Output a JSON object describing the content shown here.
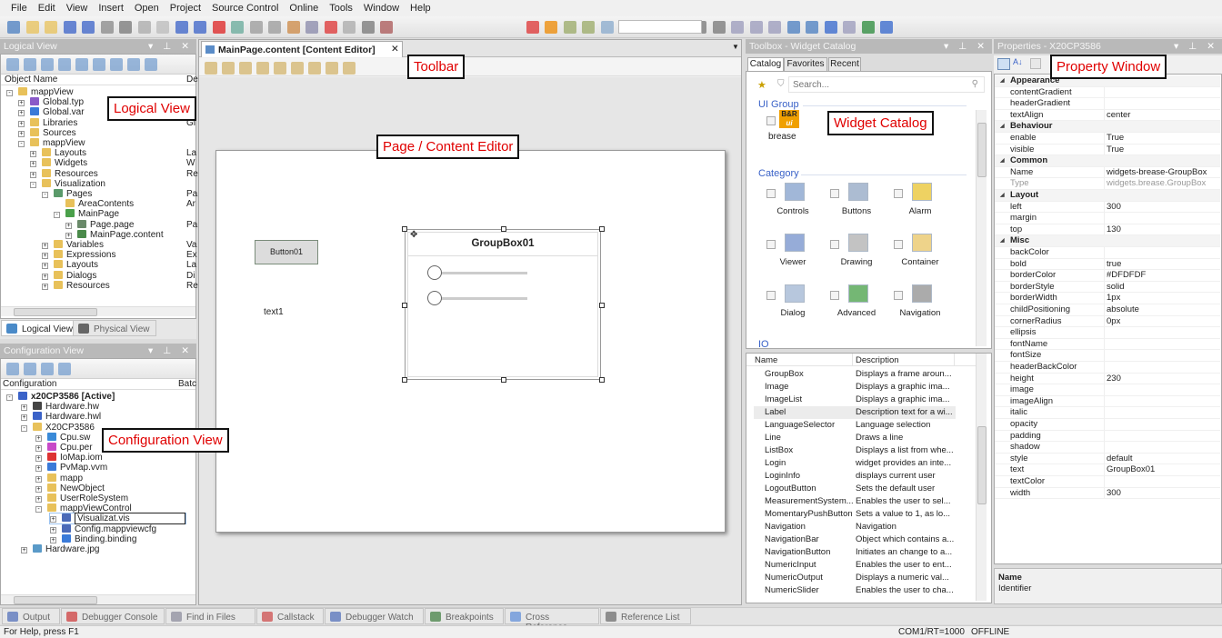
{
  "menu": [
    "File",
    "Edit",
    "View",
    "Insert",
    "Open",
    "Project",
    "Source Control",
    "Online",
    "Tools",
    "Window",
    "Help"
  ],
  "annotations": {
    "toolbar": "Toolbar",
    "logical_view": "Logical View",
    "content_editor": "Page / Content Editor",
    "widget_catalog": "Widget Catalog",
    "configuration_view": "Configuration View",
    "property_window": "Property Window"
  },
  "logical_view": {
    "title": "Logical View",
    "columns": [
      "Object Name",
      "De"
    ],
    "tree": [
      {
        "label": "mappView",
        "depth": 0,
        "exp": "-",
        "icon": "folder-open",
        "desc": ""
      },
      {
        "label": "Global.typ",
        "depth": 1,
        "exp": "+",
        "icon": "type",
        "desc": ""
      },
      {
        "label": "Global.var",
        "depth": 1,
        "exp": "+",
        "icon": "var",
        "desc": ""
      },
      {
        "label": "Libraries",
        "depth": 1,
        "exp": "+",
        "icon": "folder",
        "desc": "Gl"
      },
      {
        "label": "Sources",
        "depth": 1,
        "exp": "+",
        "icon": "folder",
        "desc": ""
      },
      {
        "label": "mappView",
        "depth": 1,
        "exp": "-",
        "icon": "folder-open",
        "desc": ""
      },
      {
        "label": "Layouts",
        "depth": 2,
        "exp": "+",
        "icon": "folder",
        "desc": "La"
      },
      {
        "label": "Widgets",
        "depth": 2,
        "exp": "+",
        "icon": "folder",
        "desc": "W"
      },
      {
        "label": "Resources",
        "depth": 2,
        "exp": "+",
        "icon": "folder",
        "desc": "Re"
      },
      {
        "label": "Visualization",
        "depth": 2,
        "exp": "-",
        "icon": "folder-open",
        "desc": ""
      },
      {
        "label": "Pages",
        "depth": 3,
        "exp": "-",
        "icon": "pages",
        "desc": "Pa"
      },
      {
        "label": "AreaContents",
        "depth": 4,
        "exp": "",
        "icon": "folder",
        "desc": "Ar"
      },
      {
        "label": "MainPage",
        "depth": 4,
        "exp": "-",
        "icon": "page",
        "desc": ""
      },
      {
        "label": "Page.page",
        "depth": 5,
        "exp": "+",
        "icon": "pagefile",
        "desc": "Pa"
      },
      {
        "label": "MainPage.content",
        "depth": 5,
        "exp": "+",
        "icon": "content",
        "desc": ""
      },
      {
        "label": "Variables",
        "depth": 3,
        "exp": "+",
        "icon": "folder",
        "desc": "Va"
      },
      {
        "label": "Expressions",
        "depth": 3,
        "exp": "+",
        "icon": "folder",
        "desc": "Ex"
      },
      {
        "label": "Layouts",
        "depth": 3,
        "exp": "+",
        "icon": "folder",
        "desc": "La"
      },
      {
        "label": "Dialogs",
        "depth": 3,
        "exp": "+",
        "icon": "folder",
        "desc": "Di"
      },
      {
        "label": "Resources",
        "depth": 3,
        "exp": "+",
        "icon": "folder",
        "desc": "Re"
      }
    ],
    "tabs": [
      "Logical View",
      "Physical View"
    ]
  },
  "configuration_view": {
    "title": "Configuration View",
    "columns": [
      "Configuration",
      "Batc"
    ],
    "tree": [
      {
        "label": "x20CP3586 [Active]",
        "depth": 0,
        "exp": "-",
        "icon": "cpu",
        "bold": true
      },
      {
        "label": "Hardware.hw",
        "depth": 1,
        "exp": "+",
        "icon": "hw"
      },
      {
        "label": "Hardware.hwl",
        "depth": 1,
        "exp": "+",
        "icon": "hwl"
      },
      {
        "label": "X20CP3586",
        "depth": 1,
        "exp": "-",
        "icon": "folder-open"
      },
      {
        "label": "Cpu.sw",
        "depth": 2,
        "exp": "+",
        "icon": "sw"
      },
      {
        "label": "Cpu.per",
        "depth": 2,
        "exp": "+",
        "icon": "per"
      },
      {
        "label": "IoMap.iom",
        "depth": 2,
        "exp": "+",
        "icon": "iom"
      },
      {
        "label": "PvMap.vvm",
        "depth": 2,
        "exp": "+",
        "icon": "vvm"
      },
      {
        "label": "mapp",
        "depth": 2,
        "exp": "+",
        "icon": "folder"
      },
      {
        "label": "NewObject",
        "depth": 2,
        "exp": "+",
        "icon": "folder"
      },
      {
        "label": "UserRoleSystem",
        "depth": 2,
        "exp": "+",
        "icon": "folder"
      },
      {
        "label": "mappViewControl",
        "depth": 2,
        "exp": "-",
        "icon": "folder-open"
      },
      {
        "label": "Visualizat.vis",
        "depth": 3,
        "exp": "+",
        "icon": "vis",
        "editing": true
      },
      {
        "label": "Config.mappviewcfg",
        "depth": 3,
        "exp": "+",
        "icon": "vis"
      },
      {
        "label": "Binding.binding",
        "depth": 3,
        "exp": "+",
        "icon": "var"
      },
      {
        "label": "Hardware.jpg",
        "depth": 1,
        "exp": "+",
        "icon": "image"
      }
    ]
  },
  "editor": {
    "tab_title": "MainPage.content [Content Editor]",
    "button_label": "Button01",
    "text_label": "text1",
    "groupbox_title": "GroupBox01",
    "sliders": [
      0,
      0
    ]
  },
  "toolbox": {
    "title": "Toolbox - Widget Catalog",
    "tabs": [
      "Catalog",
      "Favorites",
      "Recent"
    ],
    "search_placeholder": "Search...",
    "ui_group_label": "UI Group",
    "ui_group_items": [
      "brease"
    ],
    "category_label": "Category",
    "categories": [
      "Controls",
      "Buttons",
      "Alarm",
      "Viewer",
      "Drawing",
      "Container",
      "Dialog",
      "Advanced",
      "Navigation"
    ],
    "io_label": "IO",
    "list_columns": [
      "Name",
      "Description"
    ],
    "widgets": [
      {
        "name": "GroupBox",
        "desc": "Displays a frame aroun..."
      },
      {
        "name": "Image",
        "desc": "Displays a graphic ima..."
      },
      {
        "name": "ImageList",
        "desc": "Displays a graphic ima..."
      },
      {
        "name": "Label",
        "desc": "Description text for a wi...",
        "selected": true
      },
      {
        "name": "LanguageSelector",
        "desc": "Language selection"
      },
      {
        "name": "Line",
        "desc": "Draws a line"
      },
      {
        "name": "ListBox",
        "desc": "Displays a list from whe..."
      },
      {
        "name": "Login",
        "desc": "widget provides an inte..."
      },
      {
        "name": "LoginInfo",
        "desc": "displays current user"
      },
      {
        "name": "LogoutButton",
        "desc": "Sets the default user"
      },
      {
        "name": "MeasurementSystem...",
        "desc": "Enables the user to sel..."
      },
      {
        "name": "MomentaryPushButton",
        "desc": "Sets a value to 1, as lo..."
      },
      {
        "name": "Navigation",
        "desc": "Navigation"
      },
      {
        "name": "NavigationBar",
        "desc": "Object which contains a..."
      },
      {
        "name": "NavigationButton",
        "desc": "Initiates an change to a..."
      },
      {
        "name": "NumericInput",
        "desc": "Enables the user to ent..."
      },
      {
        "name": "NumericOutput",
        "desc": "Displays a numeric val..."
      },
      {
        "name": "NumericSlider",
        "desc": "Enables the user to cha..."
      }
    ]
  },
  "properties": {
    "title": "Properties - X20CP3586",
    "rows": [
      {
        "cat": true,
        "name": "Appearance"
      },
      {
        "name": "contentGradient",
        "value": ""
      },
      {
        "name": "headerGradient",
        "value": ""
      },
      {
        "name": "textAlign",
        "value": "center"
      },
      {
        "cat": true,
        "name": "Behaviour"
      },
      {
        "name": "enable",
        "value": "True"
      },
      {
        "name": "visible",
        "value": "True"
      },
      {
        "cat": true,
        "name": "Common"
      },
      {
        "name": "Name",
        "value": "widgets-brease-GroupBox"
      },
      {
        "name": "Type",
        "value": "widgets.brease.GroupBox",
        "readonly": true
      },
      {
        "cat": true,
        "name": "Layout"
      },
      {
        "name": "left",
        "value": "300"
      },
      {
        "name": "margin",
        "value": ""
      },
      {
        "name": "top",
        "value": "130"
      },
      {
        "cat": true,
        "name": "Misc"
      },
      {
        "name": "backColor",
        "value": ""
      },
      {
        "name": "bold",
        "value": "true"
      },
      {
        "name": "borderColor",
        "value": "#DFDFDF"
      },
      {
        "name": "borderStyle",
        "value": "solid"
      },
      {
        "name": "borderWidth",
        "value": "1px"
      },
      {
        "name": "childPositioning",
        "value": "absolute"
      },
      {
        "name": "cornerRadius",
        "value": "0px"
      },
      {
        "name": "ellipsis",
        "value": ""
      },
      {
        "name": "fontName",
        "value": ""
      },
      {
        "name": "fontSize",
        "value": ""
      },
      {
        "name": "headerBackColor",
        "value": ""
      },
      {
        "name": "height",
        "value": "230"
      },
      {
        "name": "image",
        "value": ""
      },
      {
        "name": "imageAlign",
        "value": ""
      },
      {
        "name": "italic",
        "value": ""
      },
      {
        "name": "opacity",
        "value": ""
      },
      {
        "name": "padding",
        "value": ""
      },
      {
        "name": "shadow",
        "value": ""
      },
      {
        "name": "style",
        "value": "default"
      },
      {
        "name": "text",
        "value": "GroupBox01"
      },
      {
        "name": "textColor",
        "value": ""
      },
      {
        "name": "width",
        "value": "300"
      }
    ],
    "desc_title": "Name",
    "desc_text": "Identifier"
  },
  "bottom_tabs": [
    "Output",
    "Debugger Console",
    "Find in Files",
    "Callstack",
    "Debugger Watch",
    "Breakpoints",
    "Cross Reference",
    "Reference List"
  ],
  "status": {
    "help": "For Help, press F1",
    "connection": "COM1/RT=1000",
    "mode": "OFFLINE"
  },
  "colors": {
    "annotation": "#e00000",
    "panel_title": "#b9b9b9",
    "folder": "#e8c15a",
    "link_blue": "#3a62c8"
  }
}
